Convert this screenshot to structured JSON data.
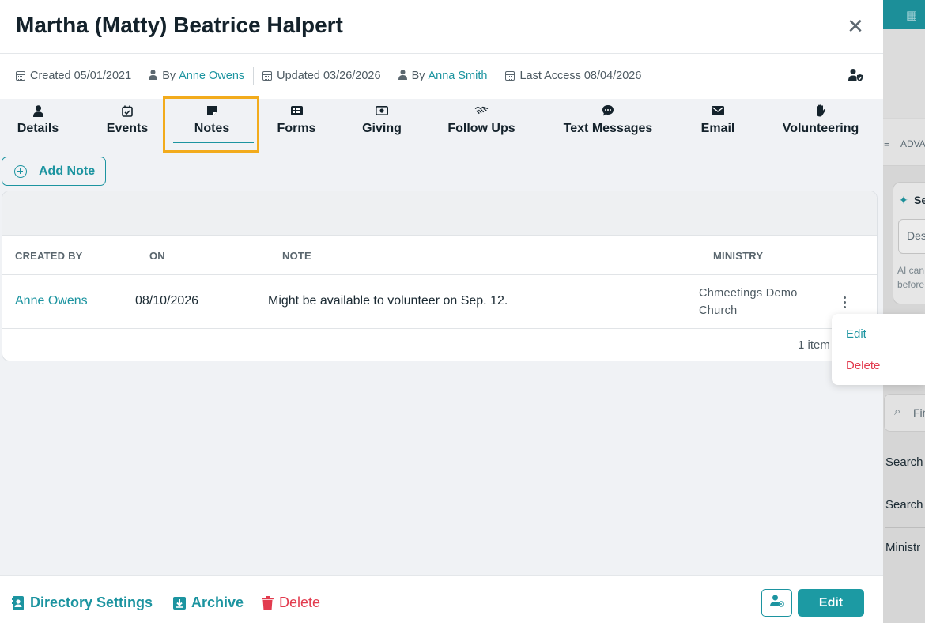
{
  "modal": {
    "title": "Martha (Matty) Beatrice Halpert",
    "close_icon": "close-icon"
  },
  "meta": {
    "created_label": "Created 05/01/2021",
    "created_by_prefix": "By",
    "created_by_name": "Anne Owens",
    "updated_label": "Updated 03/26/2026",
    "updated_by_prefix": "By",
    "updated_by_name": "Anna Smith",
    "last_access_label": "Last Access 08/04/2026"
  },
  "tabs": [
    {
      "label": "Details",
      "icon": "person-icon"
    },
    {
      "label": "Events",
      "icon": "calendar-check-icon"
    },
    {
      "label": "Notes",
      "icon": "sticky-note-icon",
      "active": true
    },
    {
      "label": "Forms",
      "icon": "form-card-icon"
    },
    {
      "label": "Giving",
      "icon": "money-icon"
    },
    {
      "label": "Follow Ups",
      "icon": "handshake-icon"
    },
    {
      "label": "Text Messages",
      "icon": "chat-bubble-icon"
    },
    {
      "label": "Email",
      "icon": "envelope-icon"
    },
    {
      "label": "Volunteering",
      "icon": "raised-hand-icon"
    }
  ],
  "notes": {
    "add_button_label": "Add Note",
    "columns": [
      "CREATED BY",
      "ON",
      "NOTE",
      "MINISTRY"
    ],
    "rows": [
      {
        "created_by": "Anne Owens",
        "on": "08/10/2026",
        "note": "Might be available to volunteer on Sep. 12.",
        "ministry": "Chmeetings Demo Church"
      }
    ],
    "count_label": "1 item"
  },
  "row_menu": {
    "edit_label": "Edit",
    "delete_label": "Delete"
  },
  "footer": {
    "directory_settings_label": "Directory Settings",
    "archive_label": "Archive",
    "delete_label": "Delete",
    "edit_label": "Edit"
  },
  "background": {
    "advanced_label": "ADVA",
    "ai_title": "Se",
    "ai_input_placeholder": "Des",
    "ai_note": "AI can before",
    "find_placeholder": "Fin",
    "rows": [
      "Search",
      "Search",
      "Ministr"
    ]
  },
  "colors": {
    "accent": "#1c94a0",
    "danger": "#e23b4e",
    "highlight": "#f2ab1c",
    "title": "#14222b"
  }
}
